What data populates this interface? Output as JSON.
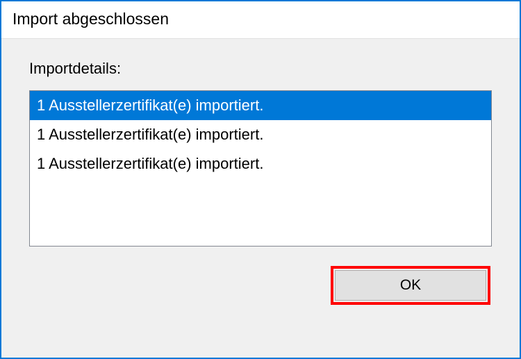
{
  "dialog": {
    "title": "Import abgeschlossen",
    "details_label": "Importdetails:",
    "items": [
      {
        "text": "1 Ausstellerzertifikat(e) importiert.",
        "selected": true
      },
      {
        "text": "1 Ausstellerzertifikat(e) importiert.",
        "selected": false
      },
      {
        "text": "1 Ausstellerzertifikat(e) importiert.",
        "selected": false
      }
    ],
    "ok_label": "OK"
  }
}
